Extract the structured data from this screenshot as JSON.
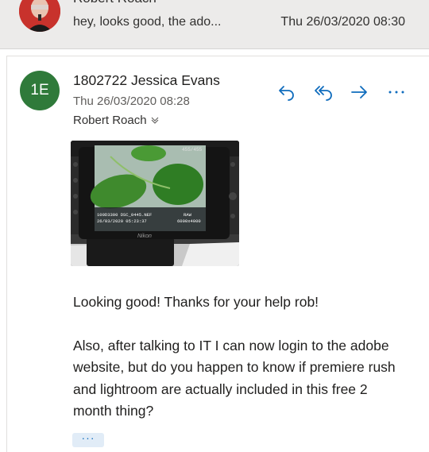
{
  "collapsed_message": {
    "sender": "Robert Roach",
    "preview": "hey, looks good, the ado...",
    "date": "Thu 26/03/2020 08:30"
  },
  "message": {
    "initials": "1E",
    "initials_color": "#2f7a3a",
    "from": "1802722 Jessica Evans",
    "date": "Thu 26/03/2020 08:28",
    "to": "Robert Roach",
    "actions": [
      "reply-icon",
      "reply-all-icon",
      "forward-icon",
      "more-icon"
    ],
    "accent_color": "#0f6cbd",
    "attachment": {
      "camera_overlay": {
        "counter": "455/455",
        "file_line_1": "100D3300   DSC_0445.NEF",
        "file_line_2": "26/03/2020 05:23:37",
        "raw_label": "RAW",
        "resolution": "6000x4000",
        "brand": "Nikon"
      }
    },
    "body": [
      "Looking good! Thanks for your help rob!",
      "Also,  after talking to IT I can now login to the adobe website, but do you happen to know if premiere rush and lightroom are actually included in this free 2 month thing?"
    ],
    "more_label": "···"
  }
}
